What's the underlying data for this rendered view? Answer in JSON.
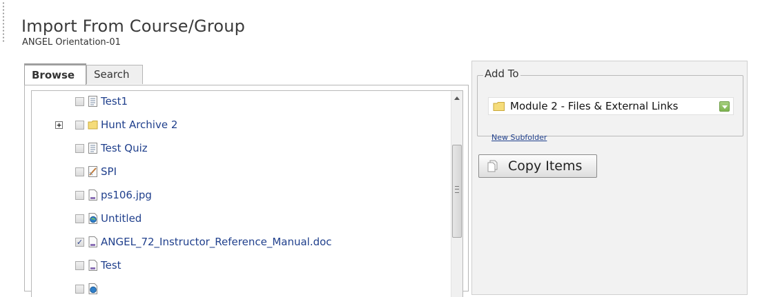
{
  "header": {
    "title": "Import From Course/Group",
    "subtitle": "ANGEL Orientation-01"
  },
  "tabs": [
    {
      "label": "Browse",
      "active": true
    },
    {
      "label": "Search",
      "active": false
    }
  ],
  "browse": {
    "items": [
      {
        "label": "Test1",
        "icon": "assessment-icon",
        "checked": false,
        "expandable": false
      },
      {
        "label": "Hunt Archive 2",
        "icon": "folder-icon",
        "checked": false,
        "expandable": true
      },
      {
        "label": "Test Quiz",
        "icon": "assessment-icon",
        "checked": false,
        "expandable": false
      },
      {
        "label": "SPI",
        "icon": "survey-icon",
        "checked": false,
        "expandable": false
      },
      {
        "label": "ps106.jpg",
        "icon": "file-icon",
        "checked": false,
        "expandable": false
      },
      {
        "label": "Untitled",
        "icon": "web-link-icon",
        "checked": false,
        "expandable": false
      },
      {
        "label": "ANGEL_72_Instructor_Reference_Manual.doc",
        "icon": "file-icon",
        "checked": true,
        "expandable": false
      },
      {
        "label": "Test",
        "icon": "file-icon",
        "checked": false,
        "expandable": false
      },
      {
        "label": "",
        "icon": "web-link-icon",
        "checked": false,
        "expandable": false
      }
    ]
  },
  "add_to": {
    "legend": "Add To",
    "selected": "Module 2 - Files & External Links",
    "new_subfolder_label": "New Subfolder"
  },
  "actions": {
    "copy_label": "Copy Items"
  },
  "colors": {
    "link": "#1f3f8c",
    "tab_accent": "#e3a22a",
    "panel_bg": "#f2f2f2",
    "dropdown_button": "#7eb551"
  }
}
